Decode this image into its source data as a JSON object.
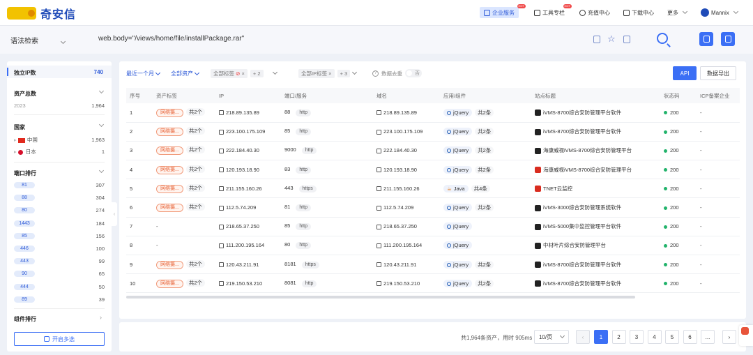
{
  "brand": {
    "name": "奇安信"
  },
  "nav": {
    "enterprise": "企业服务",
    "toolbar": "工具专栏",
    "recharge": "充值中心",
    "download": "下载中心",
    "more": "更多",
    "user": "Mannix",
    "hot_badge": "HOT"
  },
  "search": {
    "syntax_label": "语法检索",
    "query": "web.body=\"/views/home/file/installPackage.rar\""
  },
  "sidebar": {
    "unique_ip_label": "独立IP数",
    "unique_ip_value": "740",
    "assets_label": "资产总数",
    "assets_year": "2023",
    "assets_value": "1,964",
    "country_label": "国家",
    "countries": [
      {
        "name": "中国",
        "count": "1,963"
      },
      {
        "name": "日本",
        "count": "1"
      }
    ],
    "port_label": "端口排行",
    "ports": [
      {
        "port": "81",
        "count": "307"
      },
      {
        "port": "88",
        "count": "304"
      },
      {
        "port": "80",
        "count": "274"
      },
      {
        "port": "1443",
        "count": "184"
      },
      {
        "port": "85",
        "count": "156"
      },
      {
        "port": "446",
        "count": "100"
      },
      {
        "port": "443",
        "count": "99"
      },
      {
        "port": "90",
        "count": "65"
      },
      {
        "port": "444",
        "count": "50"
      },
      {
        "port": "89",
        "count": "39"
      }
    ],
    "component_label": "组件排行",
    "multi_select": "开启多选"
  },
  "filters": {
    "time": "最近一个月",
    "assets": "全部资产",
    "tags_placeholder": "全部标签",
    "tags_more": "+ 2",
    "ip_tags": "全部IP标签",
    "ip_tags_more": "+ 3",
    "dedupe": "数据去重",
    "dedupe_state": "否",
    "api": "API",
    "export": "数据导出"
  },
  "table": {
    "headers": [
      "序号",
      "资产标签",
      "IP",
      "端口/服务",
      "域名",
      "应用/组件",
      "站点标题",
      "状态码",
      "ICP备案企业"
    ],
    "rows": [
      {
        "no": "1",
        "tag": "网络摄...",
        "tag_count": "共2个",
        "ip": "218.89.135.89",
        "port": "88",
        "service": "http",
        "domain": "218.89.135.89",
        "comp": "jQuery",
        "comp_count": "共2条",
        "title": "iVMS-8700综合安防管理平台软件",
        "status": "200",
        "icp": "-"
      },
      {
        "no": "2",
        "tag": "网络摄...",
        "tag_count": "共2个",
        "ip": "223.100.175.109",
        "port": "85",
        "service": "http",
        "domain": "223.100.175.109",
        "comp": "jQuery",
        "comp_count": "共2条",
        "title": "iVMS-8700综合安防管理平台软件",
        "status": "200",
        "icp": "-"
      },
      {
        "no": "3",
        "tag": "网络摄...",
        "tag_count": "共2个",
        "ip": "222.184.40.30",
        "port": "9000",
        "service": "http",
        "domain": "222.184.40.30",
        "comp": "jQuery",
        "comp_count": "共2条",
        "title": "海康威视iVMS-8700综合安防管理平台",
        "status": "200",
        "icp": "-"
      },
      {
        "no": "4",
        "tag": "网络摄...",
        "tag_count": "共2个",
        "ip": "120.193.18.90",
        "port": "83",
        "service": "http",
        "domain": "120.193.18.90",
        "comp": "jQuery",
        "comp_count": "共2条",
        "title": "海康威视iVMS-8700综合安防管理平台",
        "status": "200",
        "icp": "-"
      },
      {
        "no": "5",
        "tag": "网络摄...",
        "tag_count": "共2个",
        "ip": "211.155.160.26",
        "port": "443",
        "service": "https",
        "domain": "211.155.160.26",
        "comp": "Java",
        "comp_count": "共4条",
        "title": "TNET云监控",
        "status": "200",
        "icp": "-"
      },
      {
        "no": "6",
        "tag": "网络摄...",
        "tag_count": "共2个",
        "ip": "112.5.74.209",
        "port": "81",
        "service": "http",
        "domain": "112.5.74.209",
        "comp": "jQuery",
        "comp_count": "共2条",
        "title": "iVMS-3000综合安防管理系统软件",
        "status": "200",
        "icp": "-"
      },
      {
        "no": "7",
        "tag": "-",
        "tag_count": "",
        "ip": "218.65.37.250",
        "port": "85",
        "service": "http",
        "domain": "218.65.37.250",
        "comp": "jQuery",
        "comp_count": "",
        "title": "iVMS-5000集中监控管理平台软件",
        "status": "200",
        "icp": "-"
      },
      {
        "no": "8",
        "tag": "-",
        "tag_count": "",
        "ip": "111.200.195.164",
        "port": "80",
        "service": "http",
        "domain": "111.200.195.164",
        "comp": "jQuery",
        "comp_count": "",
        "title": "中材叶片综合安防管理平台",
        "status": "200",
        "icp": "-"
      },
      {
        "no": "9",
        "tag": "网络摄...",
        "tag_count": "共2个",
        "ip": "120.43.211.91",
        "port": "8181",
        "service": "https",
        "domain": "120.43.211.91",
        "comp": "jQuery",
        "comp_count": "共2条",
        "title": "iVMS-8700综合安防管理平台软件",
        "status": "200",
        "icp": "-"
      },
      {
        "no": "10",
        "tag": "网络摄...",
        "tag_count": "共2个",
        "ip": "219.150.53.210",
        "port": "8081",
        "service": "http",
        "domain": "219.150.53.210",
        "comp": "jQuery",
        "comp_count": "共2条",
        "title": "iVMS-8700综合安防管理平台软件",
        "status": "200",
        "icp": "-"
      }
    ]
  },
  "pager": {
    "total": "共1,964条资产，用时 905ms",
    "page_size": "10/页",
    "pages": [
      "1",
      "2",
      "3",
      "4",
      "5",
      "6",
      "..."
    ],
    "current": "1"
  }
}
